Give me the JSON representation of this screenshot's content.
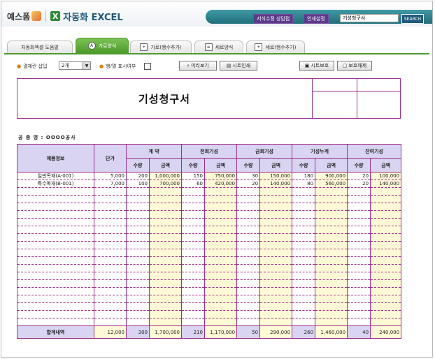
{
  "header": {
    "brand": "예스폼",
    "app_title": "자동화 EXCEL",
    "btn_request": "서식수정 상담접",
    "btn_guide": "인쇄설정",
    "search_value": "기성청구서",
    "search_label": "SEARCH"
  },
  "tabs": [
    {
      "label": "자동화엑셀 도움말",
      "active": false,
      "icon": "none"
    },
    {
      "label": "가로양식",
      "active": true,
      "icon": "a-circle-icon"
    },
    {
      "label": "가로(행수추가)",
      "active": false,
      "icon": "sheet-add-icon"
    },
    {
      "label": "세로양식",
      "active": false,
      "icon": "sheet-icon"
    },
    {
      "label": "세로(행수추가)",
      "active": false,
      "icon": "sheet-add-icon"
    }
  ],
  "toolbar": {
    "approval_label": "결재란 삽입",
    "approval_value": "2개",
    "rowcol_label": "행/열 표시여부",
    "preview_btn": "미리보기",
    "print_btn": "시트인쇄",
    "protect_btn": "시트보호",
    "unprotect_btn": "보호해제"
  },
  "document": {
    "title": "기성청구서",
    "client": "공 종 명 : OOOO공사"
  },
  "table": {
    "h_product": "제품정보",
    "h_unit_price": "단가",
    "groups": [
      "계 약",
      "전회기성",
      "금회기성",
      "기성누계",
      "잔여기성"
    ],
    "sub_qty": "수량",
    "sub_amt": "금액",
    "rows": [
      {
        "name": "일반목재(A-001)",
        "price": "5,000",
        "cells": [
          "200",
          "1,000,000",
          "150",
          "750,000",
          "30",
          "150,000",
          "180",
          "900,000",
          "20",
          "100,000"
        ]
      },
      {
        "name": "특수목재(B-001)",
        "price": "7,000",
        "cells": [
          "100",
          "700,000",
          "60",
          "420,000",
          "20",
          "140,000",
          "80",
          "560,000",
          "20",
          "140,000"
        ]
      }
    ],
    "empty_rows": 18,
    "sum_label": "합계내역",
    "sum_price": "12,000",
    "sum_cells": [
      "300",
      "1,700,000",
      "210",
      "1,170,000",
      "50",
      "290,000",
      "260",
      "1,460,000",
      "40",
      "240,000"
    ]
  }
}
